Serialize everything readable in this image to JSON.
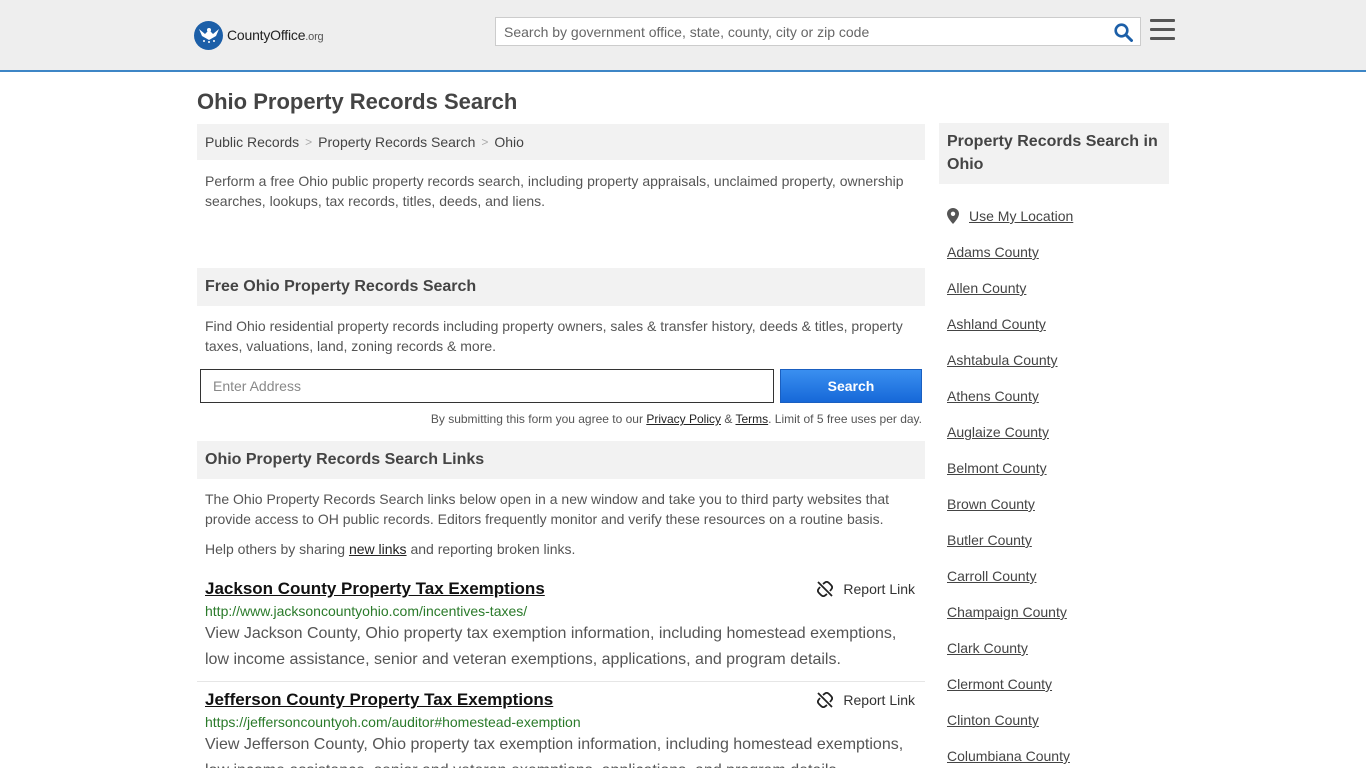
{
  "header": {
    "logo_main": "County",
    "logo_bold": "Office",
    "logo_suffix": ".org",
    "search_placeholder": "Search by government office, state, county, city or zip code"
  },
  "page_title": "Ohio Property Records Search",
  "breadcrumb": [
    "Public Records",
    "Property Records Search",
    "Ohio"
  ],
  "intro": "Perform a free Ohio public property records search, including property appraisals, unclaimed property, ownership searches, lookups, tax records, titles, deeds, and liens.",
  "free_search": {
    "heading": "Free Ohio Property Records Search",
    "text": "Find Ohio residential property records including property owners, sales & transfer history, deeds & titles, property taxes, valuations, land, zoning records & more.",
    "address_placeholder": "Enter Address",
    "button_label": "Search",
    "disclaimer_pre": "By submitting this form you agree to our ",
    "privacy_label": "Privacy Policy",
    "amp": " & ",
    "terms_label": "Terms",
    "disclaimer_post": ". Limit of 5 free uses per day."
  },
  "links_section": {
    "heading": "Ohio Property Records Search Links",
    "text": "The Ohio Property Records Search links below open in a new window and take you to third party websites that provide access to OH public records. Editors frequently monitor and verify these resources on a routine basis.",
    "help_pre": "Help others by sharing ",
    "help_link": "new links",
    "help_post": " and reporting broken links.",
    "report_label": "Report Link",
    "items": [
      {
        "title": "Jackson County Property Tax Exemptions",
        "url": "http://www.jacksoncountyohio.com/incentives-taxes/",
        "desc": "View Jackson County, Ohio property tax exemption information, including homestead exemptions, low income assistance, senior and veteran exemptions, applications, and program details."
      },
      {
        "title": "Jefferson County Property Tax Exemptions",
        "url": "https://jeffersoncountyoh.com/auditor#homestead-exemption",
        "desc": "View Jefferson County, Ohio property tax exemption information, including homestead exemptions, low income assistance, senior and veteran exemptions, applications, and program details."
      }
    ]
  },
  "sidebar": {
    "heading": "Property Records Search in Ohio",
    "use_location": "Use My Location",
    "counties": [
      "Adams County",
      "Allen County",
      "Ashland County",
      "Ashtabula County",
      "Athens County",
      "Auglaize County",
      "Belmont County",
      "Brown County",
      "Butler County",
      "Carroll County",
      "Champaign County",
      "Clark County",
      "Clermont County",
      "Clinton County",
      "Columbiana County"
    ]
  },
  "colors": {
    "header_bg": "#eeeeee",
    "accent_blue": "#3d86c6",
    "button_blue": "#1668d8",
    "url_green": "#2a7a2a"
  }
}
